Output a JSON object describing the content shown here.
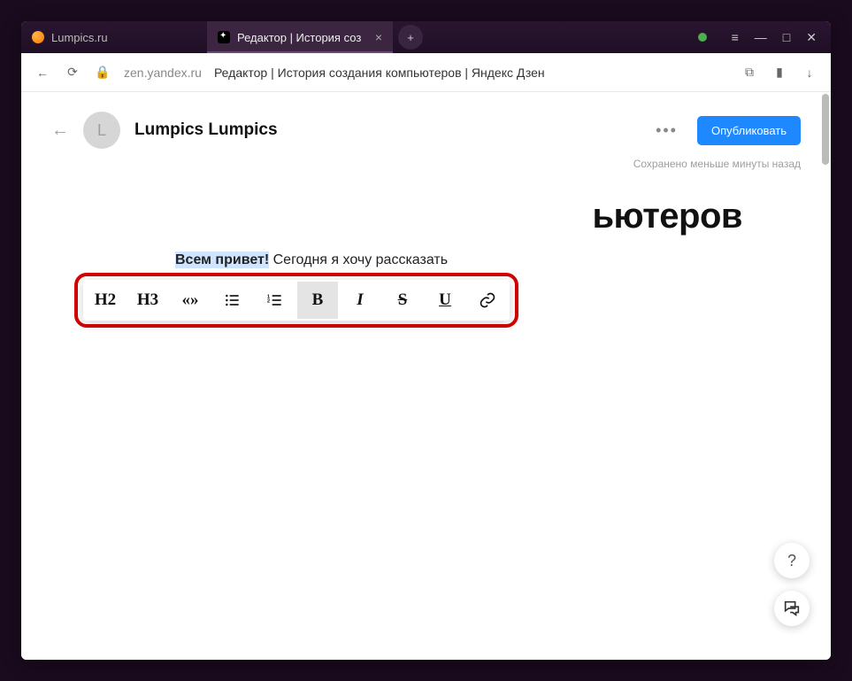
{
  "tabs": {
    "inactive": {
      "label": "Lumpics.ru"
    },
    "active": {
      "label": "Редактор | История соз",
      "close": "×"
    },
    "new": "+"
  },
  "window_controls": {
    "min": "—",
    "max": "□",
    "close": "✕",
    "menu": "≡"
  },
  "addressbar": {
    "domain": "zen.yandex.ru",
    "title": "Редактор | История создания компьютеров | Яндекс Дзен"
  },
  "editor": {
    "avatar_letter": "L",
    "author": "Lumpics Lumpics",
    "more": "•••",
    "publish": "Опубликовать",
    "saved": "Сохранено меньше минуты назад",
    "article_title_visible": "ьютеров",
    "body_bold": "Всем привет!",
    "body_rest": " Сегодня я хочу рассказать"
  },
  "toolbar": {
    "h2": "H2",
    "h3": "H3",
    "quote": "«»",
    "bold": "B",
    "italic": "I",
    "strike": "S",
    "underline": "U"
  },
  "float": {
    "help": "?"
  }
}
